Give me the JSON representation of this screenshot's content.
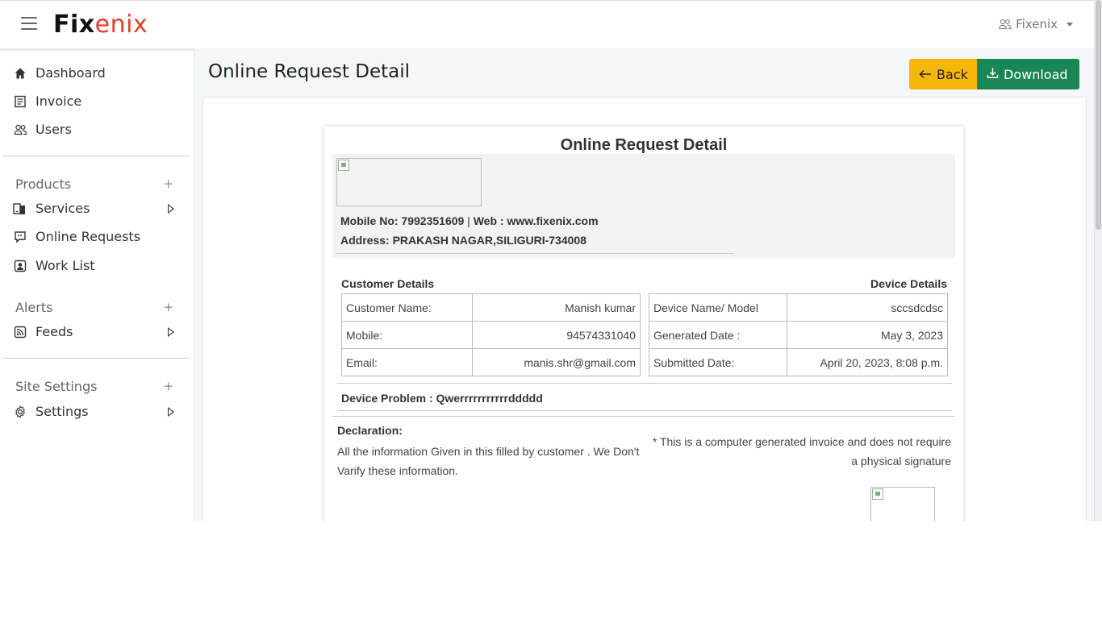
{
  "app": {
    "logo_prefix": "Fix",
    "logo_accent": "enix"
  },
  "header": {
    "user_name": "Fixenix"
  },
  "sidebar": {
    "top_items": [
      {
        "label": "Dashboard",
        "icon": "home-icon"
      },
      {
        "label": "Invoice",
        "icon": "invoice-icon"
      },
      {
        "label": "Users",
        "icon": "users-icon"
      }
    ],
    "products": {
      "title": "Products",
      "plus": "+",
      "items": [
        {
          "label": "Services",
          "icon": "devices-icon"
        },
        {
          "label": "Online Requests",
          "icon": "chat-quote-icon"
        },
        {
          "label": "Work List",
          "icon": "person-badge-icon"
        }
      ]
    },
    "alerts": {
      "title": "Alerts",
      "plus": "+",
      "items": [
        {
          "label": "Feeds",
          "icon": "rss-icon"
        }
      ]
    },
    "site_settings": {
      "title": "Site Settings",
      "plus": "+",
      "items": [
        {
          "label": "Settings",
          "icon": "gear-icon"
        }
      ]
    }
  },
  "page": {
    "title": "Online Request Detail",
    "back_label": "Back",
    "download_label": "Download"
  },
  "invoice": {
    "title": "Online Request Detail",
    "mobile_label": "Mobile No: 7992351609",
    "separator": " | ",
    "web_label": "Web : www.fixenix.com",
    "address": "Address: PRAKASH NAGAR,SILIGURI-734008",
    "customer_heading": "Customer Details",
    "device_heading": "Device Details",
    "customer_rows": [
      {
        "label": "Customer Name:",
        "value": "Manish kumar"
      },
      {
        "label": "Mobile:",
        "value": "94574331040"
      },
      {
        "label": "Email:",
        "value": "manis.shr@gmail.com"
      }
    ],
    "device_rows": [
      {
        "label": "Device Name/ Model",
        "value": "sccsdcdsc"
      },
      {
        "label": "Generated Date :",
        "value": "May 3, 2023"
      },
      {
        "label": "Submitted Date:",
        "value": "April 20, 2023, 8:08 p.m."
      }
    ],
    "device_problem": "Device Problem : Qwerrrrrrrrrrrddddd",
    "declaration_title": "Declaration:",
    "declaration_text": "All the information Given in this filled by customer . We Don't Varify these information.",
    "note": "* This is a computer generated invoice and does not require a physical signature"
  }
}
